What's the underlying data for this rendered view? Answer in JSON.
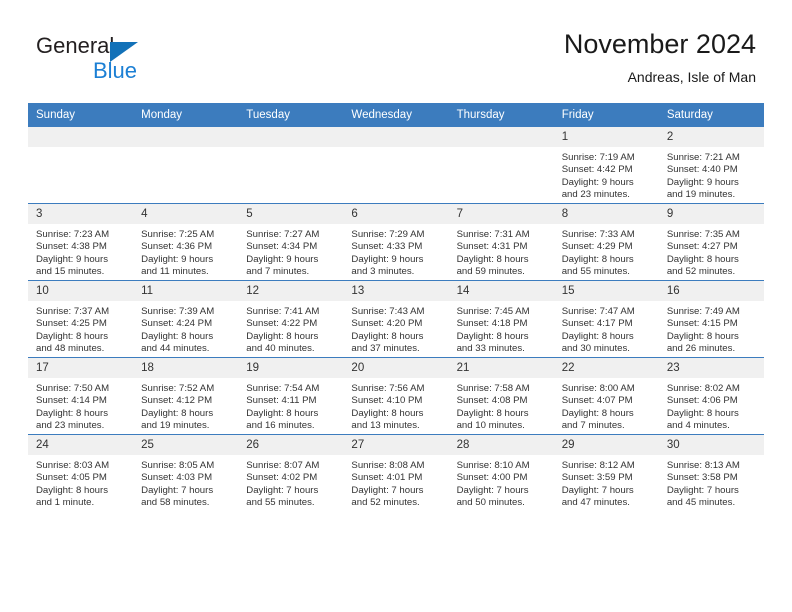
{
  "brand": {
    "name_part1": "General",
    "name_part2": "Blue",
    "triangle_icon": "triangle-icon",
    "color_dark": "#231f20",
    "color_blue": "#1b7fd4"
  },
  "header": {
    "title": "November 2024",
    "subtitle": "Andreas, Isle of Man",
    "header_bg": "#3c7cbe",
    "header_text": "#ffffff"
  },
  "weekday_headers": [
    "Sunday",
    "Monday",
    "Tuesday",
    "Wednesday",
    "Thursday",
    "Friday",
    "Saturday"
  ],
  "weeks": [
    [
      {
        "day": "",
        "empty": true,
        "sunrise": "",
        "sunset": "",
        "daylight_line1": "",
        "daylight_line2": ""
      },
      {
        "day": "",
        "empty": true,
        "sunrise": "",
        "sunset": "",
        "daylight_line1": "",
        "daylight_line2": ""
      },
      {
        "day": "",
        "empty": true,
        "sunrise": "",
        "sunset": "",
        "daylight_line1": "",
        "daylight_line2": ""
      },
      {
        "day": "",
        "empty": true,
        "sunrise": "",
        "sunset": "",
        "daylight_line1": "",
        "daylight_line2": ""
      },
      {
        "day": "",
        "empty": true,
        "sunrise": "",
        "sunset": "",
        "daylight_line1": "",
        "daylight_line2": ""
      },
      {
        "day": "1",
        "empty": false,
        "sunrise": "Sunrise: 7:19 AM",
        "sunset": "Sunset: 4:42 PM",
        "daylight_line1": "Daylight: 9 hours",
        "daylight_line2": "and 23 minutes."
      },
      {
        "day": "2",
        "empty": false,
        "sunrise": "Sunrise: 7:21 AM",
        "sunset": "Sunset: 4:40 PM",
        "daylight_line1": "Daylight: 9 hours",
        "daylight_line2": "and 19 minutes."
      }
    ],
    [
      {
        "day": "3",
        "empty": false,
        "sunrise": "Sunrise: 7:23 AM",
        "sunset": "Sunset: 4:38 PM",
        "daylight_line1": "Daylight: 9 hours",
        "daylight_line2": "and 15 minutes."
      },
      {
        "day": "4",
        "empty": false,
        "sunrise": "Sunrise: 7:25 AM",
        "sunset": "Sunset: 4:36 PM",
        "daylight_line1": "Daylight: 9 hours",
        "daylight_line2": "and 11 minutes."
      },
      {
        "day": "5",
        "empty": false,
        "sunrise": "Sunrise: 7:27 AM",
        "sunset": "Sunset: 4:34 PM",
        "daylight_line1": "Daylight: 9 hours",
        "daylight_line2": "and 7 minutes."
      },
      {
        "day": "6",
        "empty": false,
        "sunrise": "Sunrise: 7:29 AM",
        "sunset": "Sunset: 4:33 PM",
        "daylight_line1": "Daylight: 9 hours",
        "daylight_line2": "and 3 minutes."
      },
      {
        "day": "7",
        "empty": false,
        "sunrise": "Sunrise: 7:31 AM",
        "sunset": "Sunset: 4:31 PM",
        "daylight_line1": "Daylight: 8 hours",
        "daylight_line2": "and 59 minutes."
      },
      {
        "day": "8",
        "empty": false,
        "sunrise": "Sunrise: 7:33 AM",
        "sunset": "Sunset: 4:29 PM",
        "daylight_line1": "Daylight: 8 hours",
        "daylight_line2": "and 55 minutes."
      },
      {
        "day": "9",
        "empty": false,
        "sunrise": "Sunrise: 7:35 AM",
        "sunset": "Sunset: 4:27 PM",
        "daylight_line1": "Daylight: 8 hours",
        "daylight_line2": "and 52 minutes."
      }
    ],
    [
      {
        "day": "10",
        "empty": false,
        "sunrise": "Sunrise: 7:37 AM",
        "sunset": "Sunset: 4:25 PM",
        "daylight_line1": "Daylight: 8 hours",
        "daylight_line2": "and 48 minutes."
      },
      {
        "day": "11",
        "empty": false,
        "sunrise": "Sunrise: 7:39 AM",
        "sunset": "Sunset: 4:24 PM",
        "daylight_line1": "Daylight: 8 hours",
        "daylight_line2": "and 44 minutes."
      },
      {
        "day": "12",
        "empty": false,
        "sunrise": "Sunrise: 7:41 AM",
        "sunset": "Sunset: 4:22 PM",
        "daylight_line1": "Daylight: 8 hours",
        "daylight_line2": "and 40 minutes."
      },
      {
        "day": "13",
        "empty": false,
        "sunrise": "Sunrise: 7:43 AM",
        "sunset": "Sunset: 4:20 PM",
        "daylight_line1": "Daylight: 8 hours",
        "daylight_line2": "and 37 minutes."
      },
      {
        "day": "14",
        "empty": false,
        "sunrise": "Sunrise: 7:45 AM",
        "sunset": "Sunset: 4:18 PM",
        "daylight_line1": "Daylight: 8 hours",
        "daylight_line2": "and 33 minutes."
      },
      {
        "day": "15",
        "empty": false,
        "sunrise": "Sunrise: 7:47 AM",
        "sunset": "Sunset: 4:17 PM",
        "daylight_line1": "Daylight: 8 hours",
        "daylight_line2": "and 30 minutes."
      },
      {
        "day": "16",
        "empty": false,
        "sunrise": "Sunrise: 7:49 AM",
        "sunset": "Sunset: 4:15 PM",
        "daylight_line1": "Daylight: 8 hours",
        "daylight_line2": "and 26 minutes."
      }
    ],
    [
      {
        "day": "17",
        "empty": false,
        "sunrise": "Sunrise: 7:50 AM",
        "sunset": "Sunset: 4:14 PM",
        "daylight_line1": "Daylight: 8 hours",
        "daylight_line2": "and 23 minutes."
      },
      {
        "day": "18",
        "empty": false,
        "sunrise": "Sunrise: 7:52 AM",
        "sunset": "Sunset: 4:12 PM",
        "daylight_line1": "Daylight: 8 hours",
        "daylight_line2": "and 19 minutes."
      },
      {
        "day": "19",
        "empty": false,
        "sunrise": "Sunrise: 7:54 AM",
        "sunset": "Sunset: 4:11 PM",
        "daylight_line1": "Daylight: 8 hours",
        "daylight_line2": "and 16 minutes."
      },
      {
        "day": "20",
        "empty": false,
        "sunrise": "Sunrise: 7:56 AM",
        "sunset": "Sunset: 4:10 PM",
        "daylight_line1": "Daylight: 8 hours",
        "daylight_line2": "and 13 minutes."
      },
      {
        "day": "21",
        "empty": false,
        "sunrise": "Sunrise: 7:58 AM",
        "sunset": "Sunset: 4:08 PM",
        "daylight_line1": "Daylight: 8 hours",
        "daylight_line2": "and 10 minutes."
      },
      {
        "day": "22",
        "empty": false,
        "sunrise": "Sunrise: 8:00 AM",
        "sunset": "Sunset: 4:07 PM",
        "daylight_line1": "Daylight: 8 hours",
        "daylight_line2": "and 7 minutes."
      },
      {
        "day": "23",
        "empty": false,
        "sunrise": "Sunrise: 8:02 AM",
        "sunset": "Sunset: 4:06 PM",
        "daylight_line1": "Daylight: 8 hours",
        "daylight_line2": "and 4 minutes."
      }
    ],
    [
      {
        "day": "24",
        "empty": false,
        "sunrise": "Sunrise: 8:03 AM",
        "sunset": "Sunset: 4:05 PM",
        "daylight_line1": "Daylight: 8 hours",
        "daylight_line2": "and 1 minute."
      },
      {
        "day": "25",
        "empty": false,
        "sunrise": "Sunrise: 8:05 AM",
        "sunset": "Sunset: 4:03 PM",
        "daylight_line1": "Daylight: 7 hours",
        "daylight_line2": "and 58 minutes."
      },
      {
        "day": "26",
        "empty": false,
        "sunrise": "Sunrise: 8:07 AM",
        "sunset": "Sunset: 4:02 PM",
        "daylight_line1": "Daylight: 7 hours",
        "daylight_line2": "and 55 minutes."
      },
      {
        "day": "27",
        "empty": false,
        "sunrise": "Sunrise: 8:08 AM",
        "sunset": "Sunset: 4:01 PM",
        "daylight_line1": "Daylight: 7 hours",
        "daylight_line2": "and 52 minutes."
      },
      {
        "day": "28",
        "empty": false,
        "sunrise": "Sunrise: 8:10 AM",
        "sunset": "Sunset: 4:00 PM",
        "daylight_line1": "Daylight: 7 hours",
        "daylight_line2": "and 50 minutes."
      },
      {
        "day": "29",
        "empty": false,
        "sunrise": "Sunrise: 8:12 AM",
        "sunset": "Sunset: 3:59 PM",
        "daylight_line1": "Daylight: 7 hours",
        "daylight_line2": "and 47 minutes."
      },
      {
        "day": "30",
        "empty": false,
        "sunrise": "Sunrise: 8:13 AM",
        "sunset": "Sunset: 3:58 PM",
        "daylight_line1": "Daylight: 7 hours",
        "daylight_line2": "and 45 minutes."
      }
    ]
  ]
}
